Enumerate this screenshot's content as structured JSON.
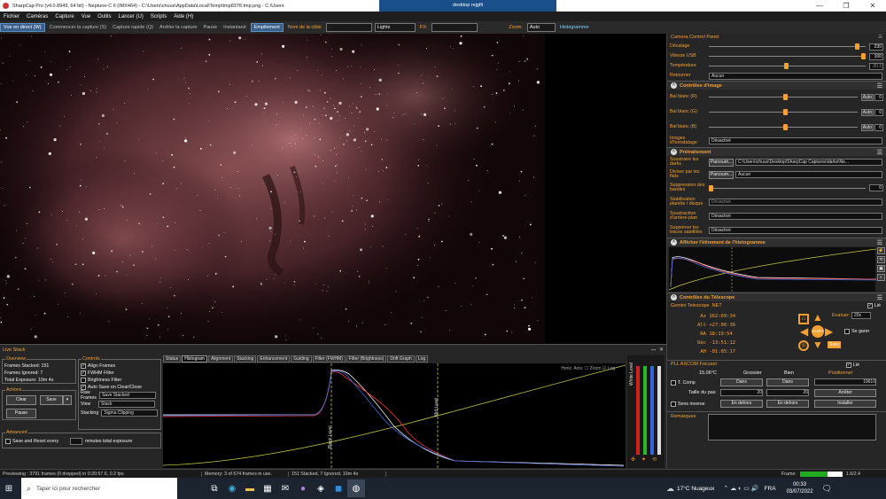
{
  "window": {
    "title": "SharpCap Pro (v4.0.8949, 64 bit) - Neptune-C II (IMX464) - C:\\Users\\chuus\\AppData\\Local\\Temp\\tmp8378.tmp.png - C:\\Users",
    "remote_tab": "desktop rejgfli",
    "min": "—",
    "max": "❐",
    "close": "✕"
  },
  "menu": [
    "Fichier",
    "Caméras",
    "Capture",
    "Vue",
    "Outils",
    "Lancer (U)",
    "Scripts",
    "Aide (H)"
  ],
  "toolbar": {
    "live_view": "Vue en direct (W)",
    "start_capture": "Commencer la capture (S)",
    "quick_capture": "Capture rapide (Q)",
    "stop_capture": "Arrêter la capture",
    "pause": "Pause",
    "snapshot": "Instantané",
    "stack": "Empilement",
    "target_label": "Nom de la cible",
    "target_value": "",
    "frame_type": "Lights",
    "fx_label": "FX:",
    "fx_value": "",
    "zoom_label": "Zoom:",
    "zoom_value": "Auto",
    "histogram": "Histogramme"
  },
  "camera_control": {
    "title": "Camera Control Panel",
    "rows": [
      {
        "label": "Décalage",
        "value": "230",
        "pos": 0.93
      },
      {
        "label": "Vitesse USB",
        "value": "100",
        "pos": 0.99
      },
      {
        "label": "Température",
        "value": "20.3",
        "pos": 0.48
      }
    ],
    "flip_label": "Retourner",
    "flip_value": "Aucun"
  },
  "image_controls": {
    "title": "Contrôles d'image",
    "rows": [
      {
        "label": "Bal blanc (R)",
        "auto": "Auto",
        "value": "0",
        "pos": 0.5
      },
      {
        "label": "Bal blanc (G)",
        "auto": "Auto",
        "value": "0",
        "pos": 0.5
      },
      {
        "label": "Bal blanc (B)",
        "auto": "Auto",
        "value": "0",
        "pos": 0.5
      }
    ],
    "timestamp_label": "Images d'horodatage",
    "timestamp_value": "Désactivé"
  },
  "preprocessing": {
    "title": "Prétraitement",
    "dark_label": "Soustraire les darks",
    "dark_browse": "Parcourir...",
    "dark_value": "C:\\Users\\chuus\\Desktop\\SharpCap Captures\\darks\\Ne...",
    "flat_label": "Diviser par les flats",
    "flat_browse": "Parcourir...",
    "flat_value": "Aucun",
    "banding_label": "Suppression des bandes",
    "banding_value": "0",
    "stab_label": "Stabilisation planète / disque",
    "stab_value": "Désactivé",
    "bg_label": "Soustraction d'arrière-plan",
    "bg_value": "Désactivé",
    "sat_label": "Supprimer les traces satellites",
    "sat_value": "Désactivé"
  },
  "histogram_panel": {
    "title": "Afficher l'étirement de l'histogramme"
  },
  "telescope": {
    "title": "Contrôles du Télescope",
    "name": "Gemini Telescope .NET",
    "link": "Lié",
    "az_label": "Az",
    "az": "162:09:34",
    "alt_label": "Alt",
    "alt": "+27:06:36",
    "ra_label": "RA",
    "ra": "18:19:54",
    "dec_label": "Déc",
    "dec": "-13:51:12",
    "ah_label": "AH",
    "ah": "-01:05:17",
    "rate_label": "Evaluer:",
    "rate": "20x",
    "park": "Se garer",
    "stop": "ARRÊT",
    "follow": "Suivi",
    "focuser_name": "PLL ASCOM Focuser",
    "focuser_link": "Lié",
    "temp": "15.06°C",
    "coarse": "Grossier",
    "fine": "Bien",
    "position_label": "Positionner",
    "position_value": "19610",
    "tcomp": "T. Comp",
    "step_label": "Taille du pas",
    "step1": "20",
    "step2": "20",
    "in": "Dans",
    "out": "En dehors",
    "stop_btn": "Arrêter",
    "install": "Installer",
    "reverse": "Sens inverse"
  },
  "remarks_label": "Remarques",
  "live_stack": {
    "title": "Live Stack",
    "overview_title": "Overview",
    "stacked_label": "Frames Stacked:",
    "stacked": "151",
    "ignored_label": "Frames Ignored:",
    "ignored": "7",
    "exposure_label": "Total Exposure:",
    "exposure": "10m 4s",
    "actions_title": "Actions",
    "clear": "Clear",
    "save": "Save",
    "pause": "Pause",
    "controls_title": "Controls",
    "align": "Align Frames",
    "fwhm": "FWHM Filter",
    "brightness": "Brightness Filter",
    "autosave": "Auto Save on Clear/Close",
    "raw_label": "Raw Frames",
    "raw_value": "Save Stacked",
    "view_label": "View",
    "view_value": "Stack",
    "stacking_label": "Stacking",
    "stacking_value": "Sigma Clipping",
    "advanced_title": "Advanced",
    "save_every": "Save and Reset every",
    "save_every_value": "",
    "save_every_unit": "minutes total exposure",
    "tabs": [
      "Status",
      "Histogram",
      "Alignment",
      "Stacking",
      "Enhancement",
      "Guiding",
      "Filter (FWHM)",
      "Filter (Brightness)",
      "Drift Graph",
      "Log"
    ],
    "hist_opts": "Horiz. Axis:  ☐ Zoom  ☑ Log",
    "black_level": "Black Level",
    "mid_level": "Mid Level",
    "white_level": "White Level"
  },
  "status": {
    "preview": "Previewing : 3791 frames (0 dropped) in 0:20:57.6, 0.2 fps",
    "memory": "Memory: 3 of 574 frames in use.",
    "stacked": "151 Stacked, 7 Ignored, 10m 4s",
    "frame_label": "Frame:",
    "frame_value": "1.6/2.4"
  },
  "taskbar": {
    "search": "Taper ici pour rechercher",
    "weather": "17°C  Nuageux",
    "lang": "FRA",
    "time": "00:33",
    "date": "03/07/2022"
  },
  "colors": {
    "accent": "#f5a030",
    "stack_active": "#3a5f8a"
  }
}
